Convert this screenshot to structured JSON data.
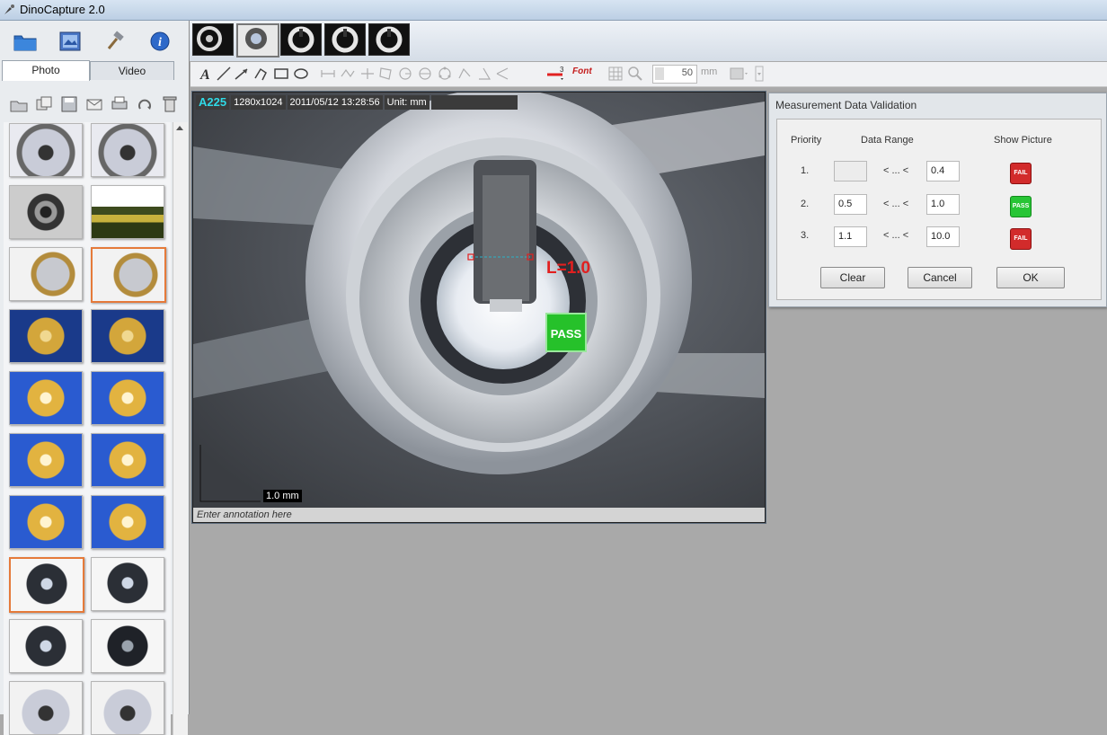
{
  "window": {
    "title": "DinoCapture 2.0"
  },
  "nav": {
    "buttons": [
      {
        "name": "folder-icon"
      },
      {
        "name": "image-settings-icon"
      },
      {
        "name": "tools-icon"
      },
      {
        "name": "info-icon"
      }
    ]
  },
  "tabs": {
    "photo": "Photo",
    "video": "Video"
  },
  "toolbar": {
    "zoom_value": "50",
    "unit_select": "mm",
    "line_width": "3",
    "font_label": "Font"
  },
  "viewer": {
    "model": "A225",
    "resolution": "1280x1024",
    "timestamp": "2011/05/12 13:28:56",
    "unit": "Unit: mm",
    "scale_bar_label": "1.0 mm",
    "measurement_label": "L=1.0",
    "pass_badge": "PASS",
    "annotation_placeholder": "Enter annotation here"
  },
  "dialog": {
    "title": "Measurement Data Validation",
    "headers": {
      "priority": "Priority",
      "range": "Data Range",
      "picture": "Show Picture"
    },
    "rows": [
      {
        "priority": "1.",
        "min": "",
        "sep": "< ... <",
        "max": "0.4",
        "picture": "FAIL"
      },
      {
        "priority": "2.",
        "min": "0.5",
        "sep": "< ... <",
        "max": "1.0",
        "picture": "PASS"
      },
      {
        "priority": "3.",
        "min": "1.1",
        "sep": "< ... <",
        "max": "10.0",
        "picture": "FAIL"
      }
    ],
    "buttons": {
      "clear": "Clear",
      "cancel": "Cancel",
      "ok": "OK"
    }
  },
  "colors": {
    "selected_thumb": "#e57a3a",
    "pass": "#27c535",
    "fail": "#d22b2b",
    "measure_label": "#e21f1f",
    "model_label": "#2fd9e6"
  }
}
